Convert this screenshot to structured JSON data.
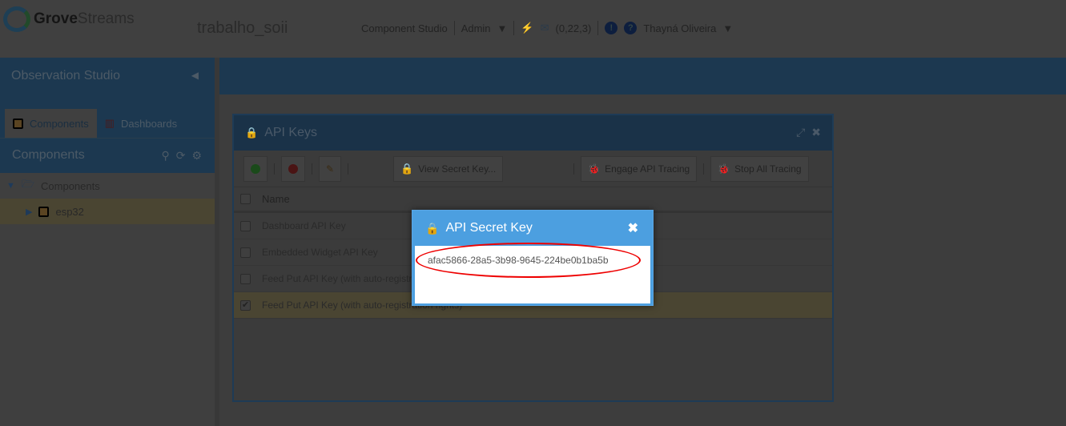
{
  "header": {
    "logo_main": "Grove",
    "logo_sub": "Streams",
    "project": "trabalho_soii",
    "nav": {
      "studio": "Component Studio",
      "admin": "Admin",
      "counts": "(0,22,3)",
      "user": "Thayná Oliveira",
      "info_icon": "!",
      "help_icon": "?"
    }
  },
  "sidebar": {
    "title": "Observation Studio",
    "tabs": [
      {
        "label": "Components"
      },
      {
        "label": "Dashboards"
      }
    ],
    "section_title": "Components",
    "tree": [
      {
        "label": "Components"
      },
      {
        "label": "esp32"
      }
    ]
  },
  "window": {
    "title": "API Keys",
    "toolbar": {
      "view_secret": "View Secret Key...",
      "engage_tracing": "Engage API Tracing",
      "stop_tracing": "Stop All Tracing"
    },
    "column_name": "Name",
    "rows": [
      {
        "name": "Dashboard API Key",
        "checked": false
      },
      {
        "name": "Embedded Widget API Key",
        "checked": false
      },
      {
        "name": "Feed Put API Key (with auto-registration rights)",
        "checked": false
      },
      {
        "name": "Feed Put API Key (with auto-registration rights)",
        "checked": true
      }
    ]
  },
  "modal": {
    "title": "API Secret Key",
    "secret": "afac5866-28a5-3b98-9645-224be0b1ba5b",
    "close": "✖"
  }
}
